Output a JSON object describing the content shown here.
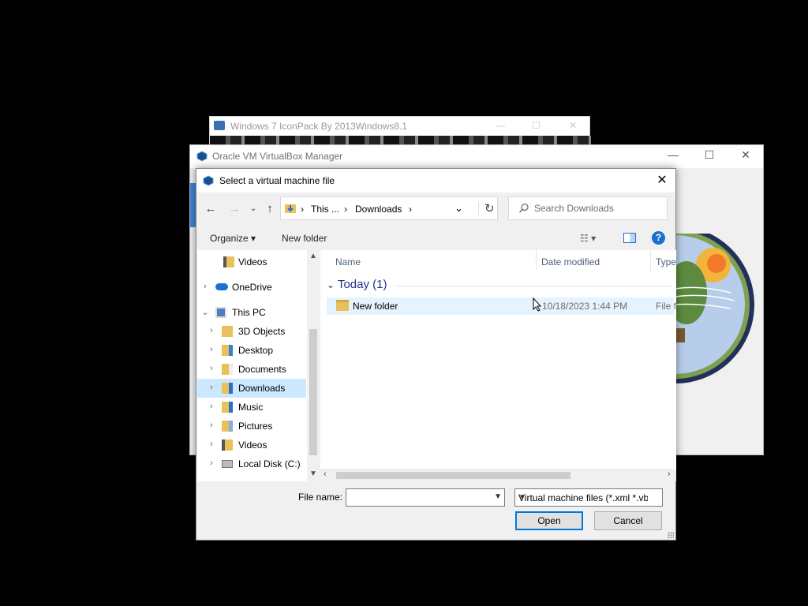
{
  "background_windows": {
    "iconpack": {
      "title": "Windows 7 IconPack By 2013Windows8.1"
    },
    "virtualbox": {
      "title": "Oracle VM VirtualBox Manager"
    }
  },
  "dialog": {
    "title": "Select a virtual machine file",
    "address": {
      "crumbs": [
        "This ...",
        "Downloads"
      ]
    },
    "search": {
      "placeholder": "Search Downloads"
    },
    "toolbar": {
      "organize": "Organize",
      "new_folder": "New folder"
    },
    "nav": {
      "items": [
        {
          "label": "Videos",
          "icon": "videos-folder-icon"
        },
        {
          "label": "OneDrive",
          "icon": "onedrive-cloud-icon"
        },
        {
          "label": "This PC",
          "icon": "computer-icon"
        },
        {
          "label": "3D Objects",
          "icon": "3d-objects-folder-icon"
        },
        {
          "label": "Desktop",
          "icon": "desktop-folder-icon"
        },
        {
          "label": "Documents",
          "icon": "documents-folder-icon"
        },
        {
          "label": "Downloads",
          "icon": "downloads-folder-icon",
          "selected": true
        },
        {
          "label": "Music",
          "icon": "music-folder-icon"
        },
        {
          "label": "Pictures",
          "icon": "pictures-folder-icon"
        },
        {
          "label": "Videos",
          "icon": "videos-folder-icon"
        },
        {
          "label": "Local Disk (C:)",
          "icon": "drive-icon"
        }
      ]
    },
    "columns": [
      "Name",
      "Date modified",
      "Type"
    ],
    "group": {
      "label": "Today (1)"
    },
    "files": [
      {
        "name": "New folder",
        "date_modified": "10/18/2023 1:44 PM",
        "type": "File fo"
      }
    ],
    "filename": {
      "label": "File name:",
      "value": ""
    },
    "filetype": {
      "value": "Virtual machine files (*.xml *.vb"
    },
    "buttons": {
      "open": "Open",
      "cancel": "Cancel"
    }
  },
  "colors": {
    "accent": "#0078d7",
    "selection": "#cce8ff",
    "group_header": "#1e3287"
  }
}
